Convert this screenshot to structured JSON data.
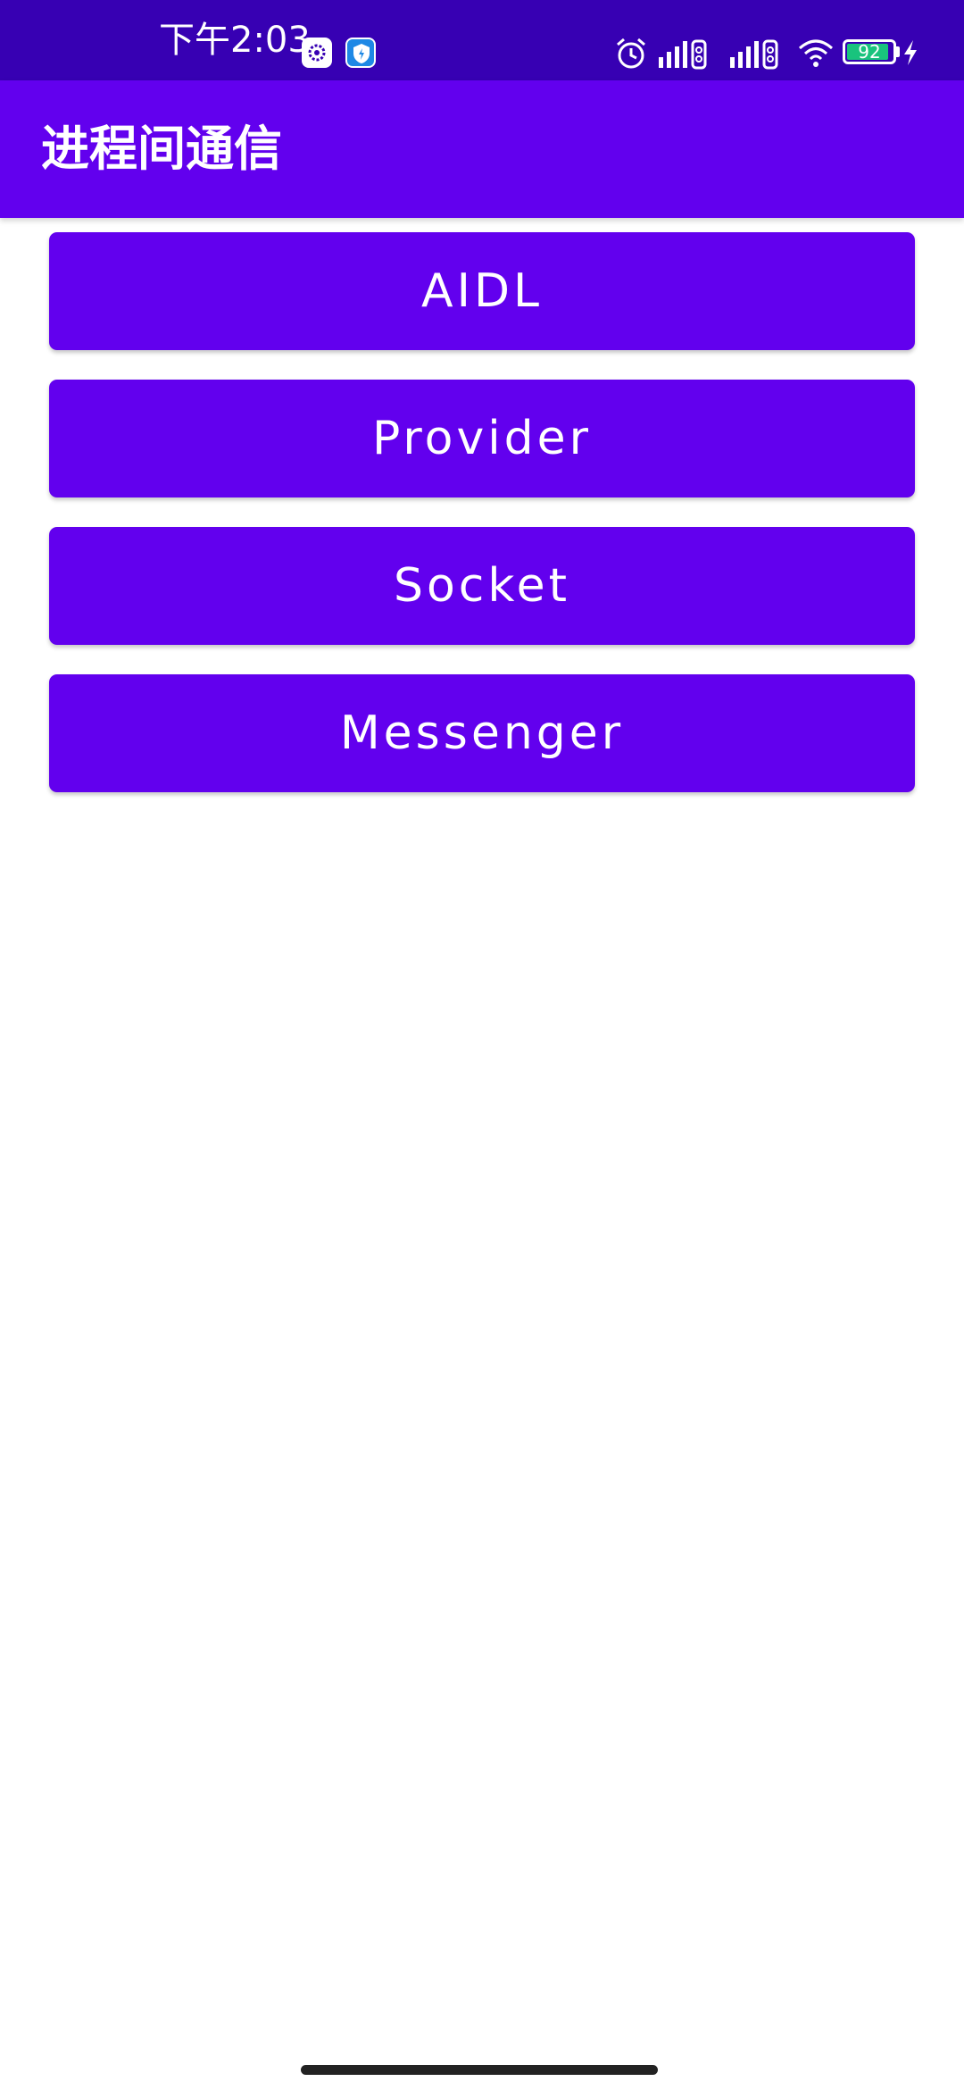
{
  "status_bar": {
    "time": "下午2:03",
    "battery_level": "92",
    "icons": [
      "settings-notification-icon",
      "shield-notification-icon",
      "alarm-icon",
      "signal-icon",
      "signal-icon",
      "wifi-icon",
      "battery-icon",
      "charging-icon"
    ]
  },
  "app_bar": {
    "title": "进程间通信"
  },
  "buttons": [
    {
      "label": "AIDL"
    },
    {
      "label": "Provider"
    },
    {
      "label": "Socket"
    },
    {
      "label": "Messenger"
    }
  ],
  "colors": {
    "status_bar": "#3700B3",
    "primary": "#6200EE",
    "on_primary": "#FFFFFF",
    "battery_fill": "#19C37D"
  }
}
